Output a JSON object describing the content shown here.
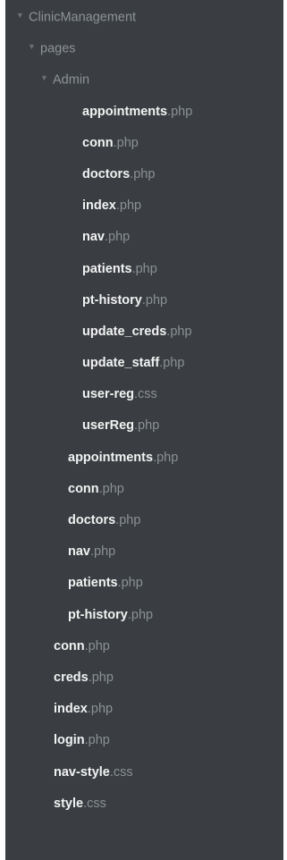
{
  "tree": {
    "root_label": "ClinicManagement",
    "pages_label": "pages",
    "admin_label": "Admin",
    "admin_files": [
      {
        "base": "appointments",
        "ext": ".php"
      },
      {
        "base": "conn",
        "ext": ".php"
      },
      {
        "base": "doctors",
        "ext": ".php"
      },
      {
        "base": "index",
        "ext": ".php"
      },
      {
        "base": "nav",
        "ext": ".php"
      },
      {
        "base": "patients",
        "ext": ".php"
      },
      {
        "base": "pt-history",
        "ext": ".php"
      },
      {
        "base": "update_creds",
        "ext": ".php"
      },
      {
        "base": "update_staff",
        "ext": ".php"
      },
      {
        "base": "user-reg",
        "ext": ".css"
      },
      {
        "base": "userReg",
        "ext": ".php"
      }
    ],
    "pages_files": [
      {
        "base": "appointments",
        "ext": ".php"
      },
      {
        "base": "conn",
        "ext": ".php"
      },
      {
        "base": "doctors",
        "ext": ".php"
      },
      {
        "base": "nav",
        "ext": ".php"
      },
      {
        "base": "patients",
        "ext": ".php"
      },
      {
        "base": "pt-history",
        "ext": ".php"
      }
    ],
    "root_files": [
      {
        "base": "conn",
        "ext": ".php"
      },
      {
        "base": "creds",
        "ext": ".php"
      },
      {
        "base": "index",
        "ext": ".php"
      },
      {
        "base": "login",
        "ext": ".php"
      },
      {
        "base": "nav-style",
        "ext": ".css"
      },
      {
        "base": "style",
        "ext": ".css"
      }
    ]
  },
  "icons": {
    "expanded_arrow": "triangle-down-icon"
  },
  "colors": {
    "panel_bg": "#3a3e42",
    "folder_text": "#8e9397",
    "file_base": "#f2f2f2",
    "file_ext": "#8c9195"
  }
}
